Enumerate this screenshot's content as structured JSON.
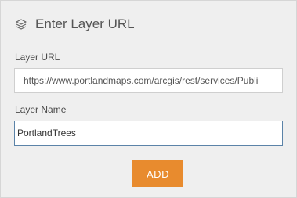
{
  "header": {
    "icon": "layers-icon",
    "title": "Enter Layer URL"
  },
  "form": {
    "url_label": "Layer URL",
    "url_value": "https://www.portlandmaps.com/arcgis/rest/services/Publi",
    "name_label": "Layer Name",
    "name_value": "PortlandTrees",
    "add_label": "ADD"
  },
  "colors": {
    "panel_bg": "#efefef",
    "accent": "#e88b2e",
    "focus_border": "#5b83a8",
    "title_text": "#555555"
  }
}
